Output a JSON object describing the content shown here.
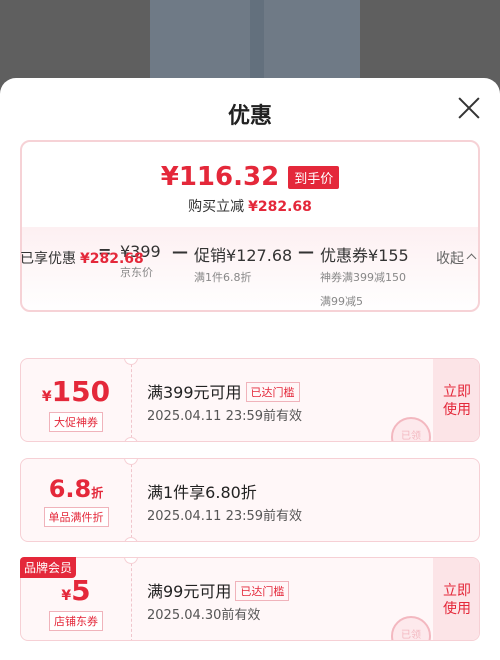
{
  "modal": {
    "title": "优惠"
  },
  "summary": {
    "final_price": "¥116.32",
    "final_badge": "到手价",
    "save_label": "购买立减",
    "save_amount": "¥282.68",
    "calc": {
      "eq": "=",
      "minus": "—",
      "base_price": "¥399",
      "base_label": "京东价",
      "promo_label": "促销",
      "promo_amount": "¥127.68",
      "promo_sub": "满1件6.8折",
      "coupon_label": "优惠券",
      "coupon_amount": "¥155",
      "coupon_sub1": "神券满399减150",
      "coupon_sub2": "满99减5"
    }
  },
  "enjoyed": {
    "label": "已享优惠",
    "amount": "¥282.68",
    "collapse_label": "收起"
  },
  "coupons": [
    {
      "yen": "¥",
      "amount": "150",
      "type": "大促神券",
      "desc": "满399元可用",
      "tag": "已达门槛",
      "valid": "2025.04.11  23:59前有效",
      "use": [
        "立即",
        "使用"
      ],
      "stamp": "已领"
    },
    {
      "amount": "6.8",
      "unit": "折",
      "type": "单品满件折",
      "desc": "满1件享6.80折",
      "valid": "2025.04.11  23:59前有效"
    },
    {
      "badge": "品牌会员",
      "yen": "¥",
      "amount": "5",
      "type": "店铺东券",
      "desc": "满99元可用",
      "tag": "已达门槛",
      "valid": "2025.04.30前有效",
      "use": [
        "立即",
        "使用"
      ],
      "stamp": "已领"
    }
  ],
  "colors": {
    "accent": "#e4283a",
    "backdrop": "#5f5f5f"
  }
}
